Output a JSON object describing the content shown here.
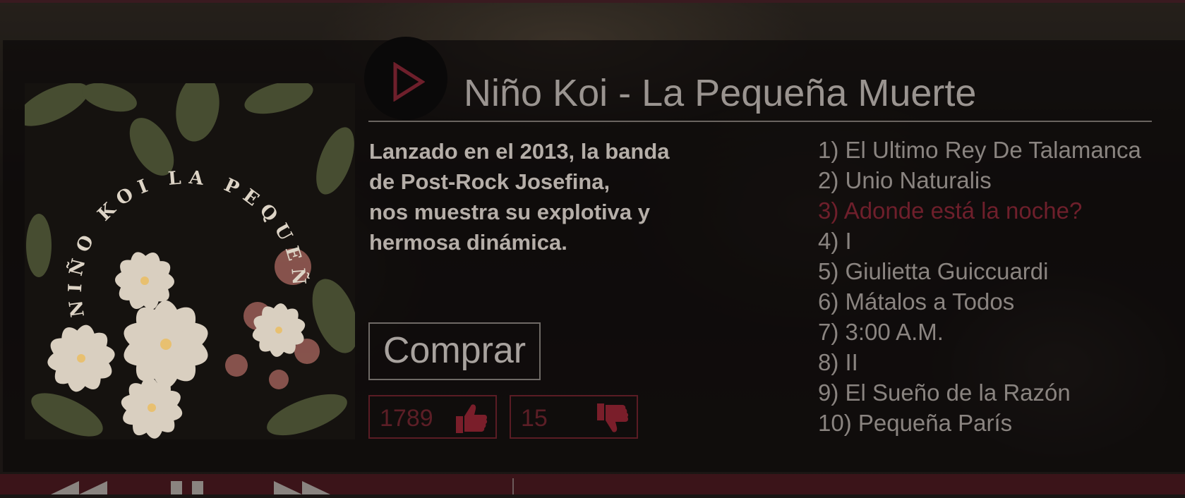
{
  "album": {
    "title": "Niño Koi - La Pequeña Muerte",
    "cover_alt_text": "NIÑO KOI LA PEQUEÑA MUERTE",
    "description_lines": [
      "Lanzado en el 2013, la banda",
      "de Post-Rock Josefina,",
      "nos muestra su explotiva y",
      "hermosa dinámica."
    ],
    "buy_label": "Comprar",
    "likes": "1789",
    "dislikes": "15"
  },
  "tracks": [
    {
      "label": "1) El Ultimo Rey De Talamanca",
      "active": false
    },
    {
      "label": "2) Unio Naturalis",
      "active": false
    },
    {
      "label": "3) Adonde está la noche?",
      "active": true
    },
    {
      "label": "4) I",
      "active": false
    },
    {
      "label": "5) Giulietta Guiccuardi",
      "active": false
    },
    {
      "label": "6) Mátalos a Todos",
      "active": false
    },
    {
      "label": "7) 3:00 A.M.",
      "active": false
    },
    {
      "label": "8) II",
      "active": false
    },
    {
      "label": "9) El Sueño de la Razón",
      "active": false
    },
    {
      "label": "10) Pequeña París",
      "active": false
    }
  ],
  "player": {
    "now_playing": "",
    "controls": [
      "rewind-icon",
      "pause-icon",
      "fast-forward-icon"
    ]
  },
  "icons": {
    "play": "play-icon",
    "like": "thumbs-up-icon",
    "dislike": "thumbs-down-icon"
  },
  "colors": {
    "accent": "#6e1f2b",
    "bar": "#3b1419",
    "vote_border": "#5a1c24"
  }
}
